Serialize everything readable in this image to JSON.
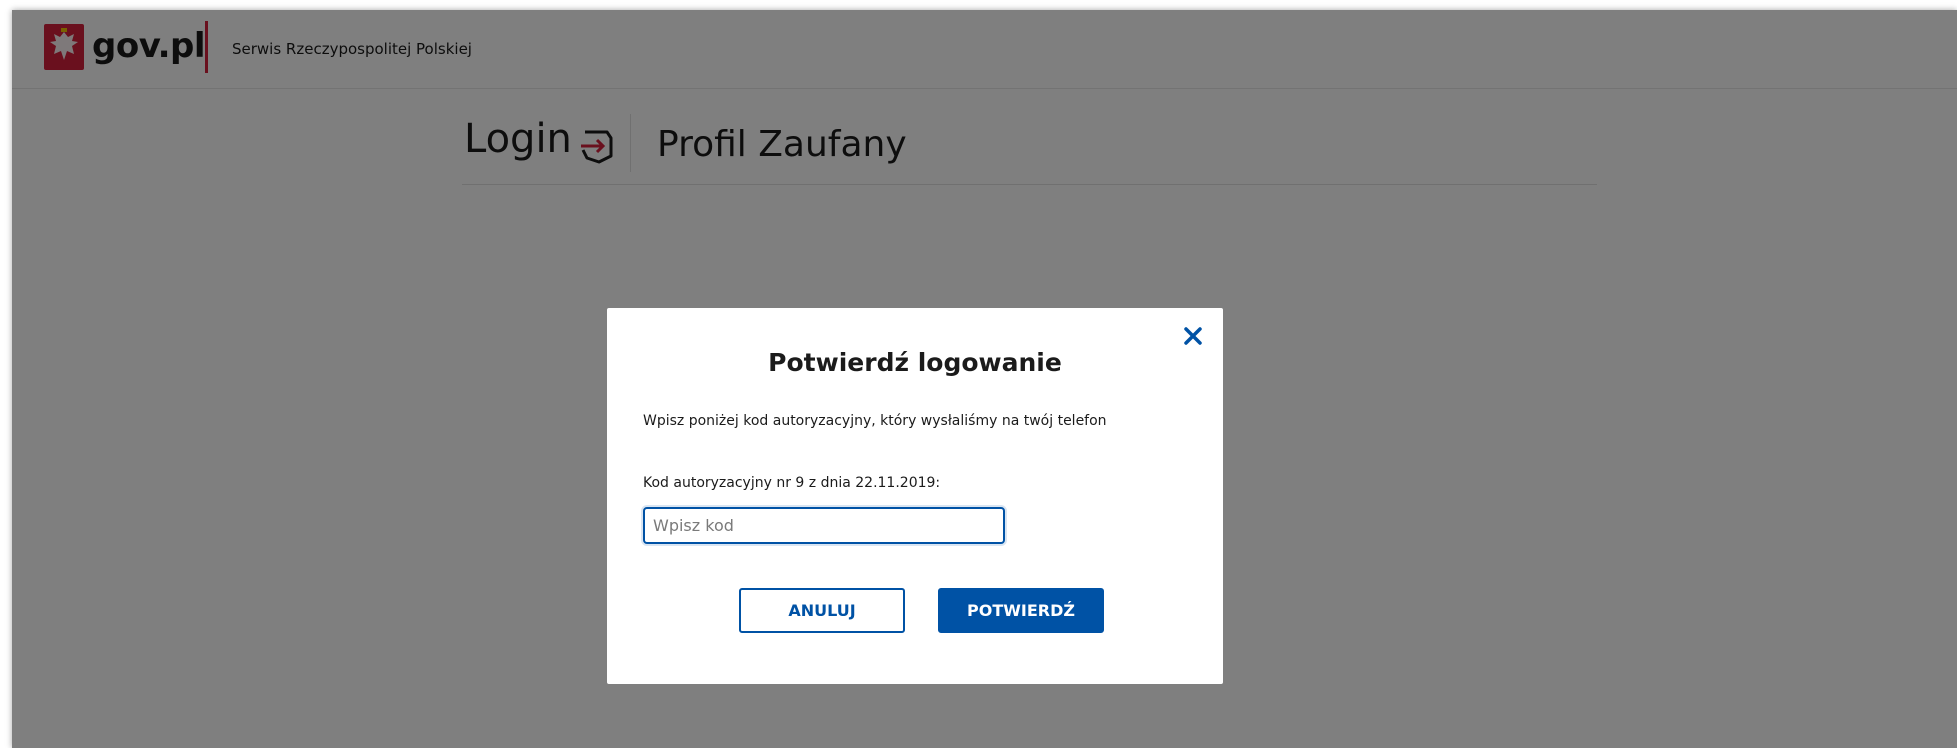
{
  "header": {
    "logo_text": "gov.pl",
    "service_name": "Serwis Rzeczypospolitej Polskiej"
  },
  "page": {
    "login_label": "Login",
    "service_title": "Profil Zaufany"
  },
  "modal": {
    "title": "Potwierdź logowanie",
    "description": "Wpisz poniżej kod autoryzacyjny, który wysłaliśmy na twój telefon",
    "code_label": "Kod autoryzacyjny nr 9 z dnia 22.11.2019:",
    "code_value": "",
    "code_placeholder": "Wpisz kod",
    "cancel_label": "ANULUJ",
    "confirm_label": "POTWIERDŹ"
  },
  "icons": {
    "emblem": "polish-eagle-emblem-icon",
    "login": "login-arrow-icon",
    "close": "close-icon"
  },
  "colors": {
    "brand_red": "#d4213d",
    "primary_blue": "#0052a5",
    "overlay": "rgba(0,0,0,0.5)"
  }
}
